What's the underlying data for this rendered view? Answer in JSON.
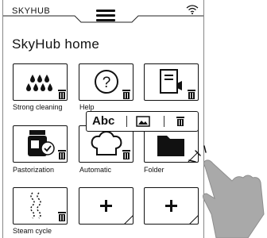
{
  "status": {
    "app_name": "SKYHUB"
  },
  "page": {
    "title": "SkyHub home"
  },
  "tiles": [
    {
      "label": "Strong cleaning",
      "icon": "drops-icon"
    },
    {
      "label": "Help",
      "icon": "help-icon"
    },
    {
      "label": "",
      "icon": "book-icon"
    },
    {
      "label": "Pastorization",
      "icon": "jar-icon"
    },
    {
      "label": "Automatic",
      "icon": "chef-hat-icon"
    },
    {
      "label": "Folder",
      "icon": "folder-icon"
    },
    {
      "label": "Steam cycle",
      "icon": "steam-icon"
    },
    {
      "label": "",
      "icon": "plus-icon"
    },
    {
      "label": "",
      "icon": "plus-icon"
    }
  ],
  "toolbar": {
    "rename_label": "Abc",
    "image_icon": "image-icon",
    "delete_icon": "trash-icon"
  },
  "colors": {
    "line": "#111111",
    "background": "#ffffff",
    "hand": "#a9a9a9"
  }
}
